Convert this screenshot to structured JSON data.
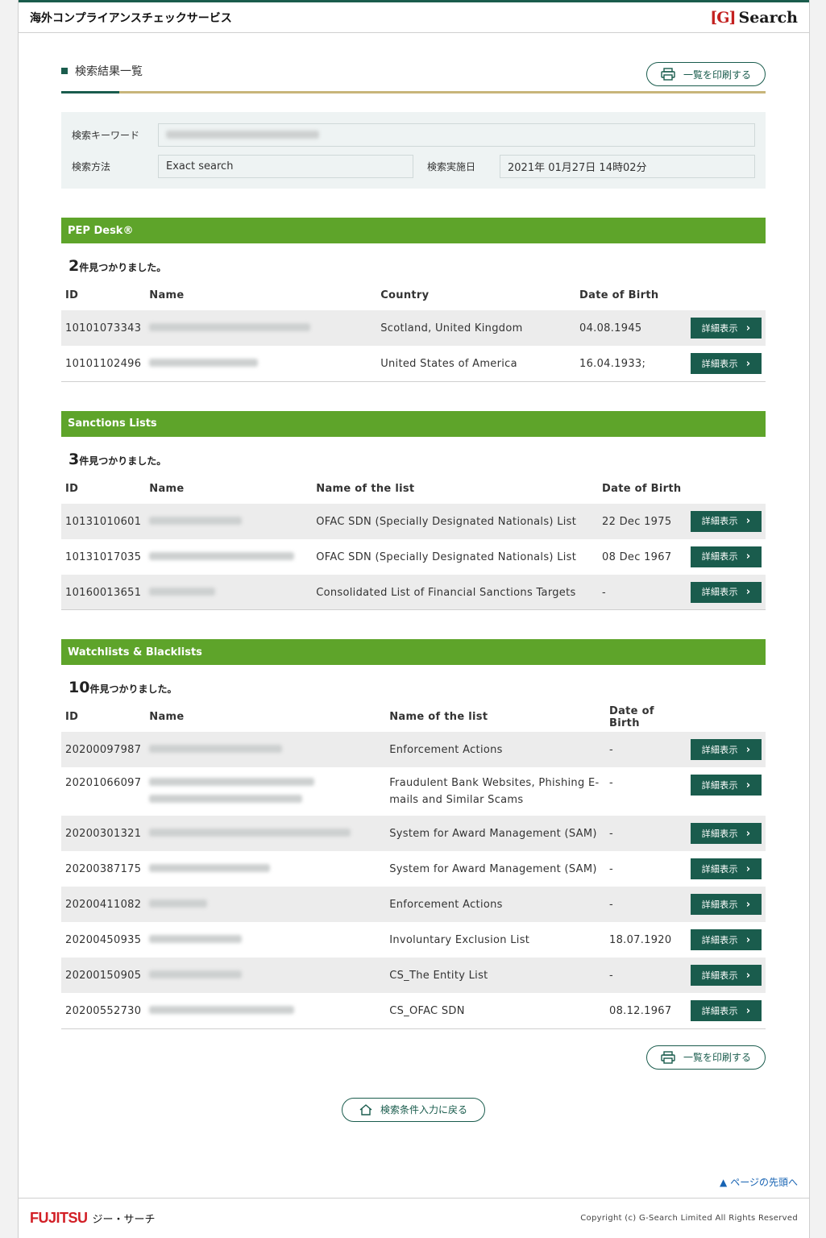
{
  "header": {
    "title": "海外コンプライアンスチェックサービス",
    "brand_mark": "[G]",
    "brand_text": "Search"
  },
  "page": {
    "heading": "検索結果一覧",
    "print_label": "一覧を印刷する",
    "back_label": "検索条件入力に戻る",
    "pagetop_label": "ページの先頭へ"
  },
  "search": {
    "keyword_label": "検索キーワード",
    "keyword_value": "",
    "method_label": "検索方法",
    "method_value": "Exact search",
    "date_label": "検索実施日",
    "date_value": "2021年 01月27日 14時02分"
  },
  "detail_label": "詳細表示",
  "count_suffix": "件見つかりました。",
  "pep": {
    "title": "PEP Desk®",
    "count": "2",
    "columns": {
      "id": "ID",
      "name": "Name",
      "country": "Country",
      "dob": "Date of Birth"
    },
    "rows": [
      {
        "id": "10101073343",
        "country": "Scotland, United Kingdom",
        "dob": "04.08.1945"
      },
      {
        "id": "10101102496",
        "country": "United States of America",
        "dob": "16.04.1933;"
      }
    ]
  },
  "sanctions": {
    "title": "Sanctions Lists",
    "count": "3",
    "columns": {
      "id": "ID",
      "name": "Name",
      "list": "Name of the list",
      "dob": "Date of Birth"
    },
    "rows": [
      {
        "id": "10131010601",
        "list": "OFAC SDN (Specially Designated Nationals) List",
        "dob": "22 Dec 1975"
      },
      {
        "id": "10131017035",
        "list": "OFAC SDN (Specially Designated Nationals) List",
        "dob": "08 Dec 1967"
      },
      {
        "id": "10160013651",
        "list": "Consolidated List of Financial Sanctions Targets",
        "dob": "-"
      }
    ]
  },
  "watch": {
    "title": "Watchlists & Blacklists",
    "count": "10",
    "columns": {
      "id": "ID",
      "name": "Name",
      "list": "Name of the list",
      "dob": "Date of Birth"
    },
    "rows": [
      {
        "id": "20200097987",
        "list": "Enforcement Actions",
        "dob": "-"
      },
      {
        "id": "20201066097",
        "list": "Fraudulent Bank Websites, Phishing E-mails and Similar Scams",
        "dob": "-"
      },
      {
        "id": "20200301321",
        "list": "System for Award Management (SAM)",
        "dob": "-"
      },
      {
        "id": "20200387175",
        "list": "System for Award Management (SAM)",
        "dob": "-"
      },
      {
        "id": "20200411082",
        "list": "Enforcement Actions",
        "dob": "-"
      },
      {
        "id": "20200450935",
        "list": "Involuntary Exclusion List",
        "dob": "18.07.1920"
      },
      {
        "id": "20200150905",
        "list": "CS_The Entity List",
        "dob": "-"
      },
      {
        "id": "20200552730",
        "list": "CS_OFAC SDN",
        "dob": "08.12.1967"
      }
    ]
  },
  "footer": {
    "company": "FUJITSU",
    "company_jp": "ジー・サーチ",
    "copyright": "Copyright (c) G-Search Limited All Rights Reserved"
  },
  "colors": {
    "primary": "#1a5c4d",
    "section_bar": "#5ea42a",
    "accent_line": "#c8b57a",
    "link": "#1763b3"
  }
}
